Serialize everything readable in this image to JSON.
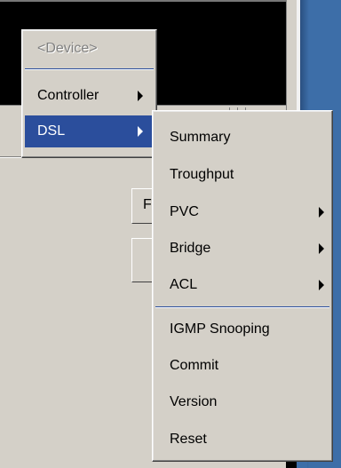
{
  "device_menu": {
    "items": [
      {
        "label": "<Device>",
        "disabled": true
      },
      {
        "label": "Controller",
        "has_submenu": true
      },
      {
        "label": "DSL",
        "has_submenu": true,
        "selected": true
      }
    ]
  },
  "dsl_submenu": {
    "items": [
      {
        "label": "Summary"
      },
      {
        "label": "Troughput"
      },
      {
        "label": "PVC",
        "has_submenu": true
      },
      {
        "label": "Bridge",
        "has_submenu": true
      },
      {
        "label": "ACL",
        "has_submenu": true
      },
      {
        "label": "IGMP Snooping"
      },
      {
        "label": "Commit"
      },
      {
        "label": "Version"
      },
      {
        "label": "Reset"
      }
    ]
  },
  "background": {
    "button_partial_label": "F"
  },
  "colors": {
    "menu_bg": "#d4d0c8",
    "highlight": "#2b4e9c",
    "separator": "#2b4e9c",
    "disabled_text": "#808080"
  }
}
